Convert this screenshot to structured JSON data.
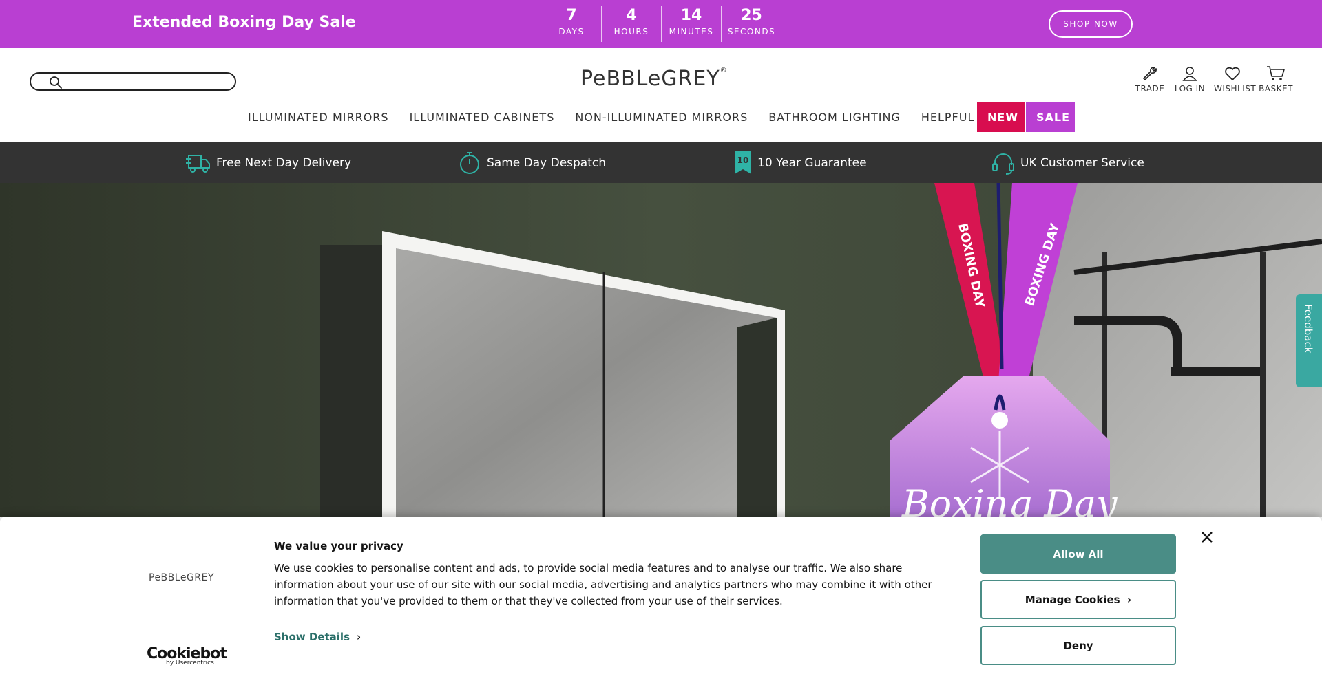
{
  "promo": {
    "title": "Extended Boxing Day Sale",
    "countdown": [
      {
        "value": "7",
        "label": "DAYS"
      },
      {
        "value": "4",
        "label": "HOURS"
      },
      {
        "value": "14",
        "label": "MINUTES"
      },
      {
        "value": "25",
        "label": "SECONDS"
      }
    ],
    "cta": "SHOP NOW",
    "color": "#b93fd2"
  },
  "header": {
    "search_placeholder": "",
    "logo_pebble": "PeBBLe",
    "logo_grey": "GREY",
    "logo_reg": "®",
    "utilities": [
      {
        "label": "TRADE",
        "icon": "wrench-icon"
      },
      {
        "label": "LOG IN",
        "icon": "user-icon"
      },
      {
        "label": "WISHLIST",
        "icon": "heart-icon"
      },
      {
        "label": "BASKET",
        "icon": "basket-icon"
      }
    ]
  },
  "nav": {
    "items": [
      "ILLUMINATED MIRRORS",
      "ILLUMINATED CABINETS",
      "NON-ILLUMINATED MIRRORS",
      "BATHROOM LIGHTING",
      "HELPFUL TOOLS"
    ],
    "new_label": "NEW",
    "sale_label": "SALE",
    "new_color": "#d80d4f"
  },
  "usp": [
    {
      "label": "Free Next Day Delivery",
      "icon": "delivery-truck-icon"
    },
    {
      "label": "Same Day Despatch",
      "icon": "stopwatch-icon"
    },
    {
      "label": "10 Year Guarantee",
      "icon": "guarantee-badge-icon"
    },
    {
      "label": "UK Customer Service",
      "icon": "headset-icon"
    }
  ],
  "hero": {
    "ribbon_text_left": "BOXING DAY",
    "ribbon_text_right": "BOXING DAY",
    "tag_script": "Boxing Day"
  },
  "feedback": {
    "label": "Feedback"
  },
  "cookie": {
    "logo": "PeBBLeGREY",
    "title": "We value your privacy",
    "body": "We use cookies to personalise content and ads, to provide social media features and to analyse our traffic. We also share information about your use of our site with our social media, advertising and analytics partners who may combine it with other information that you've provided to them or that they've collected from your use of their services.",
    "show_details": "Show Details",
    "allow_all": "Allow All",
    "manage": "Manage Cookies",
    "deny": "Deny",
    "brand": "Cookiebot",
    "brand_sub": "by Usercentrics",
    "accent": "#4a8d86"
  }
}
